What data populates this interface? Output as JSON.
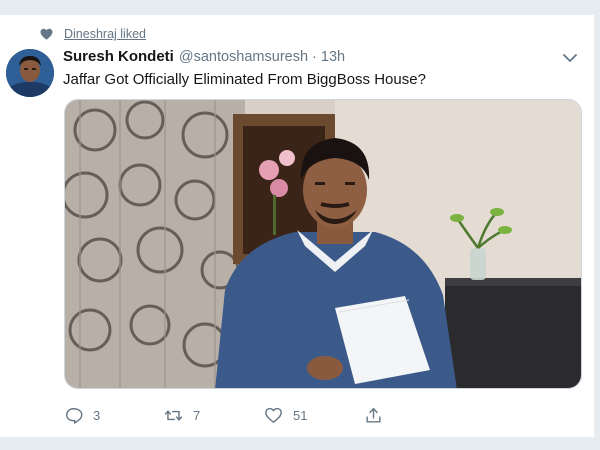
{
  "social_context": {
    "icon": "heart-icon",
    "text": "Dineshraj liked"
  },
  "tweet": {
    "display_name": "Suresh Kondeti",
    "handle": "@santoshamsuresh",
    "separator": "·",
    "timestamp": "13h",
    "text": "Jaffar Got Officially Eliminated From BiggBoss House?",
    "media_icon": "photo"
  },
  "actions": {
    "reply_count": "3",
    "retweet_count": "7",
    "like_count": "51"
  },
  "colors": {
    "accent_gray": "#657786",
    "text": "#14171a",
    "background": "#e6ecf0",
    "card": "#ffffff"
  }
}
